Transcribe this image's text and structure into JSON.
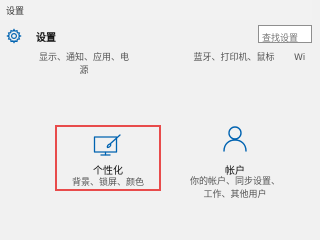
{
  "window": {
    "title": "设置"
  },
  "header": {
    "heading": "设置",
    "icon": "gear-icon"
  },
  "search": {
    "placeholder": "查找设置"
  },
  "top_categories": [
    {
      "line1": "显示、通知、应用、电",
      "line2": "源"
    },
    {
      "line1": "蓝牙、打印机、鼠标",
      "line2": ""
    },
    {
      "line1": "Wi",
      "line2": ""
    }
  ],
  "tiles": [
    {
      "icon": "personalization-icon",
      "title": "个性化",
      "desc_line1": "背景、锁屏、颜色",
      "desc_line2": "",
      "highlight_color": "#e84b4b"
    },
    {
      "icon": "accounts-icon",
      "title": "帐户",
      "desc_line1": "你的帐户、同步设置、",
      "desc_line2": "工作、其他用户"
    }
  ],
  "colors": {
    "accent": "#0063b1",
    "highlight": "#e84b4b",
    "background": "#f1f1f1"
  }
}
